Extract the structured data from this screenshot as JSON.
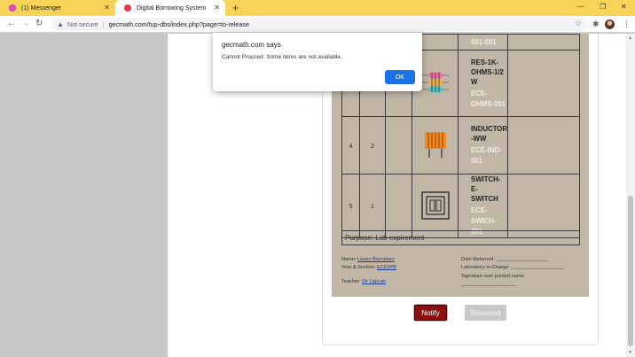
{
  "browser": {
    "tabs": [
      {
        "title": "(1) Messenger",
        "favicon": "messenger-icon",
        "color": "#a334fa"
      },
      {
        "title": "Digital Borrowing System",
        "favicon": "site-icon",
        "color": "#e8344e"
      }
    ],
    "security_label": "Not secure",
    "url": "gecmath.com/tup-dbs/index.php?page=to-release"
  },
  "items": [
    {
      "no": "",
      "qty": "",
      "name": "",
      "code": "001-001",
      "icon": "component-icon"
    },
    {
      "no": "",
      "qty": "",
      "name": "RES-1K-OHMS-1/2W",
      "name_lines": [
        "RES-1K-",
        "OHMS-1/2",
        "W"
      ],
      "code_lines": [
        "ECE-",
        "OHMS-001"
      ],
      "icon": "resistor-icon"
    },
    {
      "no": "4",
      "qty": "2",
      "name_lines": [
        "INDUCTOR",
        "-WW"
      ],
      "code_lines": [
        "ECE-IND-",
        "001"
      ],
      "icon": "inductor-icon"
    },
    {
      "no": "5",
      "qty": "1",
      "name_lines": [
        "SWITCH-E-",
        "SWITCH"
      ],
      "code_lines": [
        "ECE-",
        "SWICH-001"
      ],
      "icon": "switch-icon"
    }
  ],
  "purpose": "Purpose: Lab expirement",
  "borrower": {
    "name_label": "Name:",
    "name": "Lenen Borromeo",
    "year_section_label": "Year & Section:",
    "year_section": "ECE5PB",
    "teacher_label": "Teacher:",
    "teacher": "Sir Lapi-an"
  },
  "return_fields": {
    "date_returned": "Date Returned: ___________________",
    "lab_in_charge": "Laboratory-in-Charge: ___________________",
    "signature": "Signature over printed name:",
    "signature_line": "____________________"
  },
  "buttons": {
    "notify": "Notify",
    "released": "Released"
  },
  "dialog": {
    "title": "gecmath.com says",
    "message": "Cannot Procced: Some items are not available.",
    "ok": "OK"
  },
  "colors": {
    "accent": "#1a73e8",
    "notify": "#8b0f0f",
    "form_bg": "#c2b6a6",
    "tab_strip": "#f7d358"
  }
}
